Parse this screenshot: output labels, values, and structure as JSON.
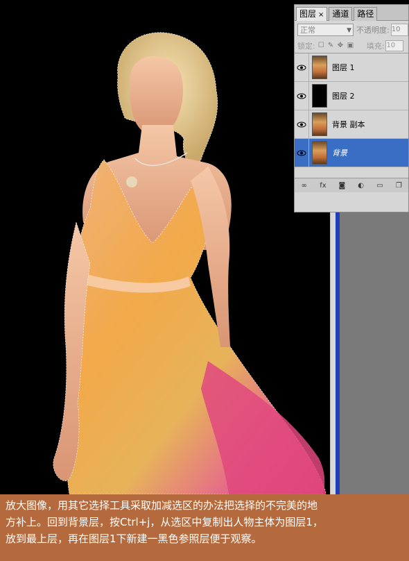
{
  "layers_panel": {
    "tabs": [
      {
        "label": "图层",
        "close": "×"
      },
      {
        "label": "通道"
      },
      {
        "label": "路径"
      }
    ],
    "blend_mode": "正常",
    "opacity_label": "不透明度:",
    "opacity_value": "10",
    "lock_label": "锁定:",
    "fill_label": "填充:",
    "fill_value": "10",
    "layers": [
      {
        "name": "图层 1",
        "thumb": "photo",
        "selected": false
      },
      {
        "name": "图层 2",
        "thumb": "black",
        "selected": false
      },
      {
        "name": "背景 副本",
        "thumb": "photo",
        "selected": false
      },
      {
        "name": "背景",
        "thumb": "photo",
        "selected": true
      }
    ],
    "footer_icons": [
      "link-icon",
      "fx-icon",
      "mask-icon",
      "adjustment-icon",
      "folder-icon",
      "new-layer-icon"
    ]
  },
  "caption": {
    "line1": "放大图像，用其它选择工具采取加减选区的办法把选择的不完美的地",
    "line2": "方补上。回到背景层，按Ctrl+j，从选区中复制出人物主体为图层1，",
    "line3": "放到最上层，再在图层1下新建一黑色参照层便于观察。"
  },
  "colors": {
    "caption_bg": "#b46a3c",
    "selected_layer": "#3a6ec5"
  }
}
